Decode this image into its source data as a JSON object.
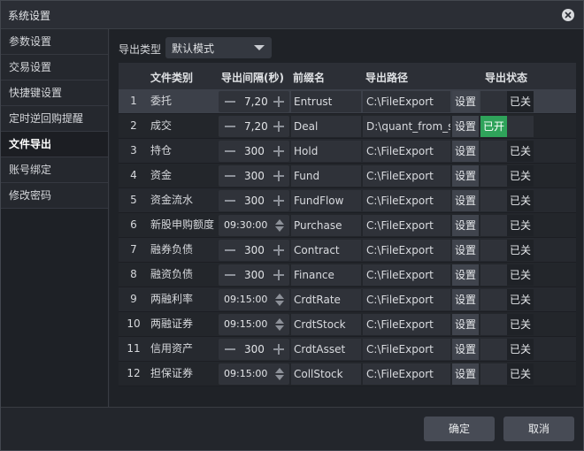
{
  "window": {
    "title": "系统设置"
  },
  "sidebar": {
    "items": [
      {
        "label": "参数设置"
      },
      {
        "label": "交易设置"
      },
      {
        "label": "快捷键设置"
      },
      {
        "label": "定时逆回购提醒"
      },
      {
        "label": "文件导出"
      },
      {
        "label": "账号绑定"
      },
      {
        "label": "修改密码"
      }
    ],
    "active": "文件导出"
  },
  "export": {
    "type_label": "导出类型",
    "mode_value": "默认模式"
  },
  "table": {
    "headers": {
      "type": "文件类别",
      "interval": "导出间隔(秒)",
      "prefix": "前缀名",
      "path": "导出路径",
      "status": "导出状态"
    },
    "set_label": "设置",
    "rows": [
      {
        "idx": "1",
        "type": "委托",
        "interval": "7,20",
        "prefix": "Entrust",
        "path": "C:\\FileExport",
        "status": "已关"
      },
      {
        "idx": "2",
        "type": "成交",
        "interval": "7,20",
        "prefix": "Deal",
        "path": "D:\\quant_from_s",
        "status": "已开"
      },
      {
        "idx": "3",
        "type": "持仓",
        "interval": "300",
        "prefix": "Hold",
        "path": "C:\\FileExport",
        "status": "已关"
      },
      {
        "idx": "4",
        "type": "资金",
        "interval": "300",
        "prefix": "Fund",
        "path": "C:\\FileExport",
        "status": "已关"
      },
      {
        "idx": "5",
        "type": "资金流水",
        "interval": "300",
        "prefix": "FundFlow",
        "path": "C:\\FileExport",
        "status": "已关"
      },
      {
        "idx": "6",
        "type": "新股申购额度",
        "interval": "09:30:00",
        "prefix": "Purchase",
        "path": "C:\\FileExport",
        "status": "已关"
      },
      {
        "idx": "7",
        "type": "融券负债",
        "interval": "300",
        "prefix": "Contract",
        "path": "C:\\FileExport",
        "status": "已关"
      },
      {
        "idx": "8",
        "type": "融资负债",
        "interval": "300",
        "prefix": "Finance",
        "path": "C:\\FileExport",
        "status": "已关"
      },
      {
        "idx": "9",
        "type": "两融利率",
        "interval": "09:15:00",
        "prefix": "CrdtRate",
        "path": "C:\\FileExport",
        "status": "已关"
      },
      {
        "idx": "10",
        "type": "两融证券",
        "interval": "09:15:00",
        "prefix": "CrdtStock",
        "path": "C:\\FileExport",
        "status": "已关"
      },
      {
        "idx": "11",
        "type": "信用资产",
        "interval": "300",
        "prefix": "CrdtAsset",
        "path": "C:\\FileExport",
        "status": "已关"
      },
      {
        "idx": "12",
        "type": "担保证券",
        "interval": "09:15:00",
        "prefix": "CollStock",
        "path": "C:\\FileExport",
        "status": "已关"
      }
    ]
  },
  "footer": {
    "ok_label": "确定",
    "cancel_label": "取消"
  },
  "colors": {
    "on_green": "#2fa35a",
    "background": "#1f2227"
  }
}
